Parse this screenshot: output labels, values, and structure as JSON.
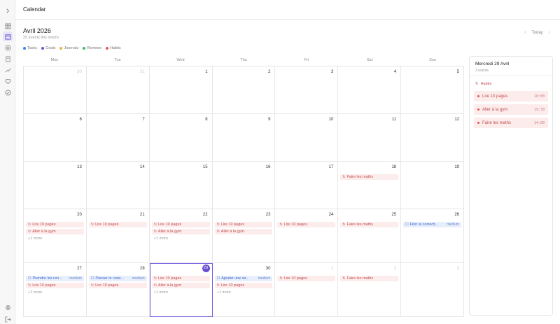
{
  "app": {
    "title": "Calendar"
  },
  "header": {
    "month": "Avril 2026",
    "count": "25 events this month",
    "today_label": "Today",
    "prev_icon": "chevron-left",
    "next_icon": "chevron-right"
  },
  "legend": [
    {
      "label": "Tasks",
      "color": "#3b82f6"
    },
    {
      "label": "Goals",
      "color": "#6d4fd6"
    },
    {
      "label": "Journals",
      "color": "#e8b23a"
    },
    {
      "label": "Reviews",
      "color": "#3dbb6a"
    },
    {
      "label": "Habits",
      "color": "#e05b5b"
    }
  ],
  "sidebar": {
    "icons": [
      "expand-icon",
      "dashboard-icon",
      "calendar-icon",
      "target-icon",
      "journal-icon",
      "trend-icon",
      "heart-icon",
      "check-icon",
      "settings-icon",
      "logout-icon"
    ]
  },
  "days_of_week": [
    "Mon",
    "Tue",
    "Wed",
    "Thu",
    "Fri",
    "Sat",
    "Sun"
  ],
  "weeks": [
    [
      {
        "n": "30",
        "out": true
      },
      {
        "n": "31",
        "out": true
      },
      {
        "n": "1"
      },
      {
        "n": "2"
      },
      {
        "n": "3"
      },
      {
        "n": "4"
      },
      {
        "n": "5"
      }
    ],
    [
      {
        "n": "6"
      },
      {
        "n": "7"
      },
      {
        "n": "8"
      },
      {
        "n": "9"
      },
      {
        "n": "10"
      },
      {
        "n": "11"
      },
      {
        "n": "12"
      }
    ],
    [
      {
        "n": "13"
      },
      {
        "n": "14"
      },
      {
        "n": "15"
      },
      {
        "n": "16"
      },
      {
        "n": "17"
      },
      {
        "n": "18",
        "events": [
          {
            "type": "habit",
            "label": "Faire les maths"
          }
        ]
      },
      {
        "n": "19"
      }
    ],
    [
      {
        "n": "20",
        "events": [
          {
            "type": "habit",
            "label": "Lire 10 pages"
          },
          {
            "type": "habit",
            "label": "Aller à la gym"
          }
        ],
        "more": "+1 more"
      },
      {
        "n": "21",
        "events": [
          {
            "type": "habit",
            "label": "Lire 10 pages"
          }
        ]
      },
      {
        "n": "22",
        "events": [
          {
            "type": "habit",
            "label": "Lire 10 pages"
          },
          {
            "type": "habit",
            "label": "Aller à la gym"
          }
        ],
        "more": "+1 more"
      },
      {
        "n": "23",
        "events": [
          {
            "type": "habit",
            "label": "Lire 10 pages"
          },
          {
            "type": "habit",
            "label": "Aller à la gym"
          }
        ]
      },
      {
        "n": "24",
        "events": [
          {
            "type": "habit",
            "label": "Lire 10 pages"
          }
        ]
      },
      {
        "n": "25",
        "events": [
          {
            "type": "habit",
            "label": "Faire les maths"
          }
        ]
      },
      {
        "n": "26",
        "events": [
          {
            "type": "task",
            "label": "Finir la correcti...",
            "priority": "medium"
          }
        ]
      }
    ],
    [
      {
        "n": "27",
        "events": [
          {
            "type": "task",
            "label": "Prendre les ren...",
            "priority": "medium"
          },
          {
            "type": "habit",
            "label": "Lire 10 pages"
          }
        ],
        "more": "+2 more"
      },
      {
        "n": "28",
        "events": [
          {
            "type": "task",
            "label": "Penser le conc...",
            "priority": "medium"
          },
          {
            "type": "habit",
            "label": "Lire 10 pages"
          }
        ]
      },
      {
        "n": "29",
        "today": true,
        "events": [
          {
            "type": "habit",
            "label": "Lire 10 pages"
          },
          {
            "type": "habit",
            "label": "Aller à la gym"
          }
        ],
        "more": "+1 more"
      },
      {
        "n": "30",
        "events": [
          {
            "type": "task",
            "label": "Ajouter une se...",
            "priority": "medium"
          },
          {
            "type": "habit",
            "label": "Lire 10 pages"
          }
        ],
        "more": "+1 more"
      },
      {
        "n": "1",
        "out": true,
        "events": [
          {
            "type": "habit",
            "label": "Lire 10 pages"
          }
        ]
      },
      {
        "n": "2",
        "out": true,
        "events": [
          {
            "type": "habit",
            "label": "Faire les maths"
          }
        ]
      },
      {
        "n": "3",
        "out": true
      }
    ]
  ],
  "panel": {
    "date": "Mercredi 29 Avril",
    "count": "3 events",
    "section": "Habits",
    "items": [
      {
        "label": "Lire 10 pages",
        "time": "18:00"
      },
      {
        "label": "Aller à la gym",
        "time": "19:30"
      },
      {
        "label": "Faire les maths",
        "time": "14:00"
      }
    ]
  }
}
